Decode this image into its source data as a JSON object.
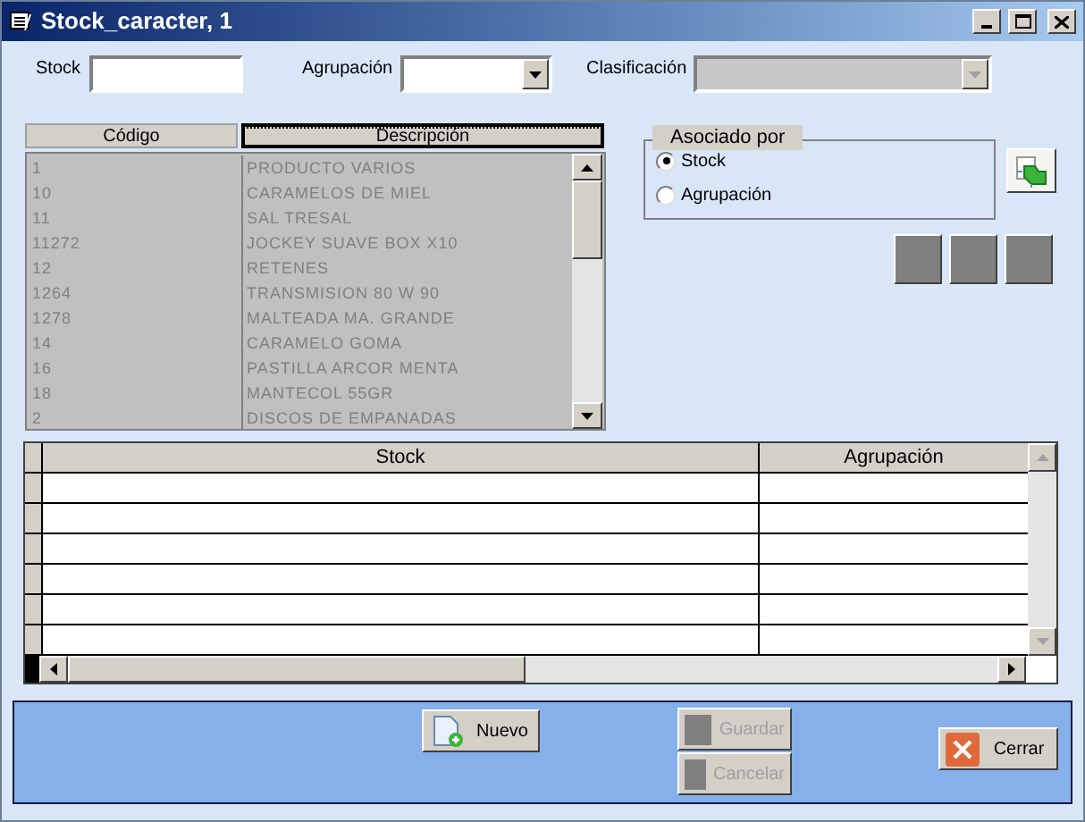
{
  "window": {
    "title": "Stock_caracter, 1"
  },
  "filters": [
    {
      "label": "Stock",
      "kind": "text",
      "disabled": false
    },
    {
      "label": "Agrupación",
      "kind": "combo",
      "disabled": false
    },
    {
      "label": "Clasificación",
      "kind": "combo",
      "disabled": true
    }
  ],
  "list": {
    "columns": [
      {
        "label": "Código",
        "selected": false
      },
      {
        "label": "Descripción",
        "selected": true
      }
    ],
    "rows": [
      {
        "code": "1",
        "description": "PRODUCTO VARIOS"
      },
      {
        "code": "10",
        "description": "CARAMELOS DE MIEL"
      },
      {
        "code": "11",
        "description": "SAL TRESAL"
      },
      {
        "code": "11272",
        "description": "JOCKEY SUAVE BOX X10"
      },
      {
        "code": "12",
        "description": "RETENES"
      },
      {
        "code": "1264",
        "description": "TRANSMISION 80 W 90"
      },
      {
        "code": "1278",
        "description": "MALTEADA MA. GRANDE"
      },
      {
        "code": "14",
        "description": "CARAMELO GOMA"
      },
      {
        "code": "16",
        "description": "PASTILLA ARCOR MENTA"
      },
      {
        "code": "18",
        "description": "MANTECOL 55GR"
      },
      {
        "code": "2",
        "description": "DISCOS DE EMPANADAS"
      }
    ]
  },
  "asociado_por": {
    "title": "Asociado por",
    "options": [
      {
        "label": "Stock",
        "selected": true
      },
      {
        "label": "Agrupación",
        "selected": false
      }
    ]
  },
  "grid": {
    "columns": [
      "Stock",
      "Agrupación"
    ]
  },
  "buttons": [
    {
      "label": "Nuevo",
      "kind": "new",
      "disabled": false
    },
    {
      "label": "Guardar",
      "kind": "blank",
      "disabled": true
    },
    {
      "label": "Cancelar",
      "kind": "blank",
      "disabled": true
    },
    {
      "label": "Cerrar",
      "kind": "close",
      "disabled": false
    }
  ]
}
